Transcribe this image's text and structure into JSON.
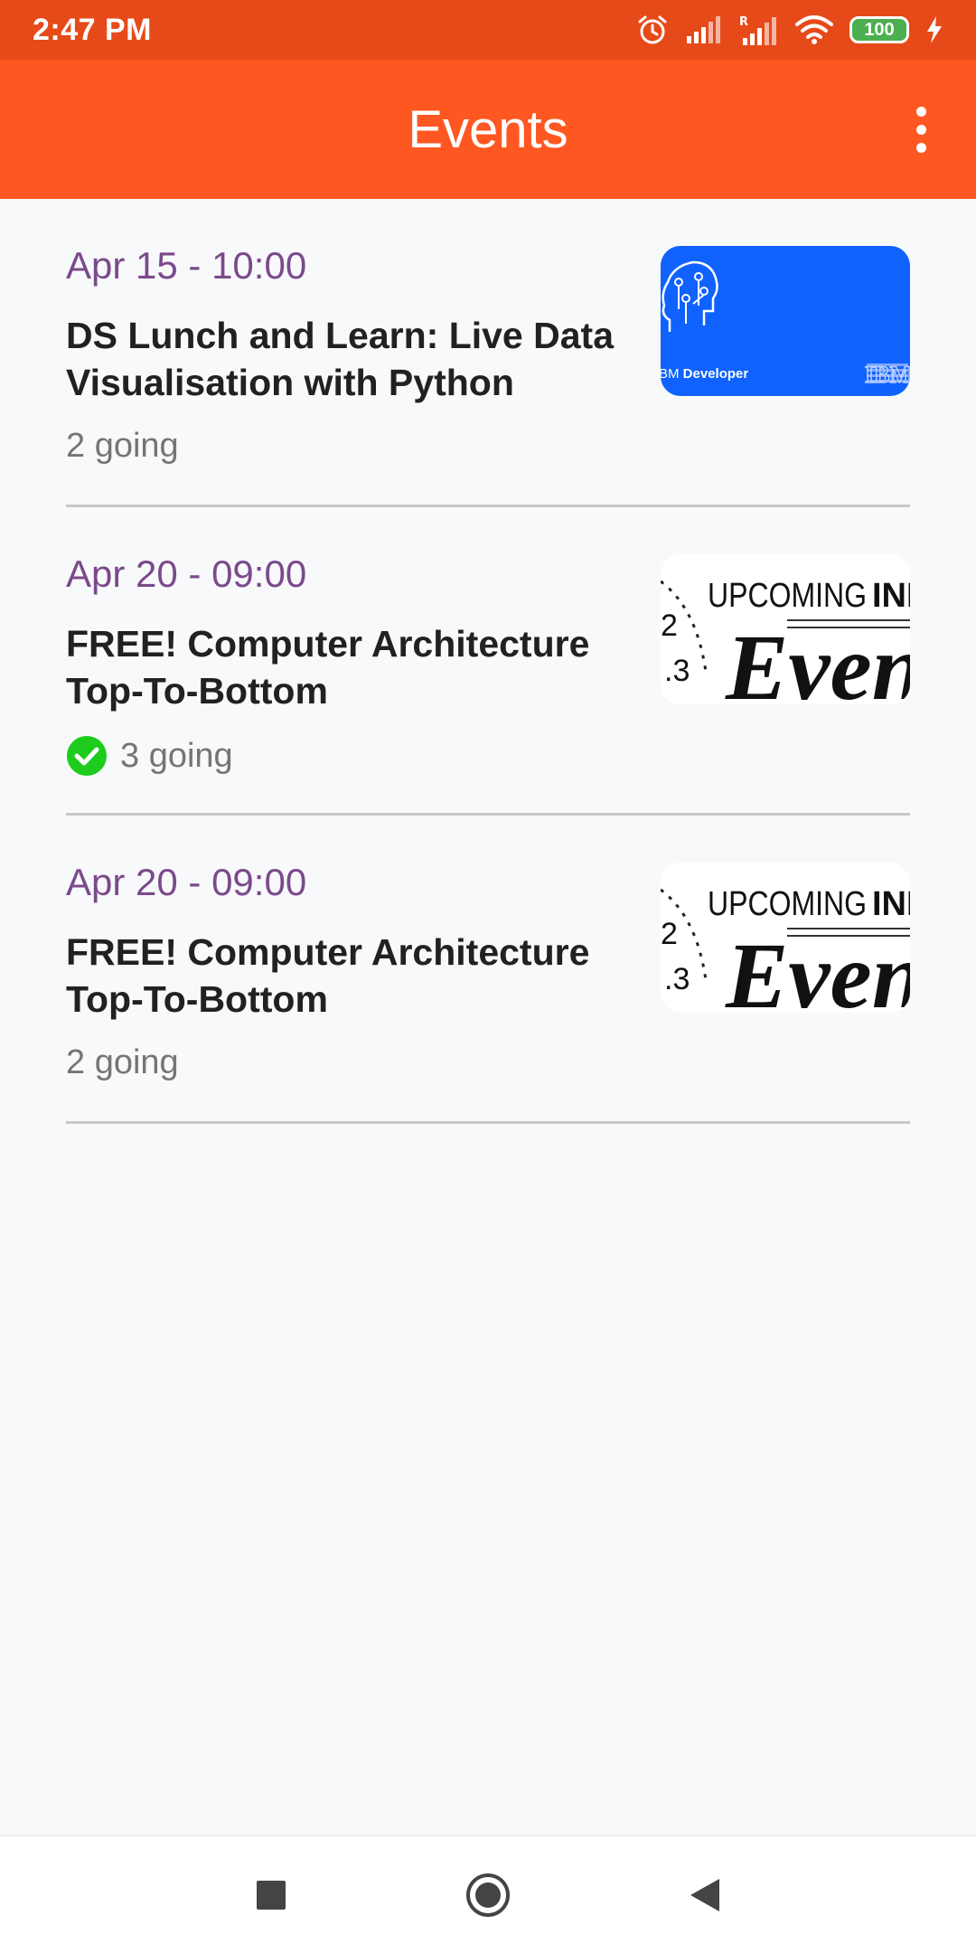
{
  "status_bar": {
    "time": "2:47 PM",
    "battery": "100",
    "icons": [
      "alarm-icon",
      "signal-icon",
      "roaming-signal-icon",
      "wifi-icon",
      "battery-icon",
      "charging-icon"
    ]
  },
  "app_bar": {
    "title": "Events",
    "menu_icon": "more-vertical-icon"
  },
  "events": [
    {
      "date": "Apr 15 - 10:00",
      "title": "DS Lunch and Learn: Live Data Visualisation with Python",
      "going": "2 going",
      "attending": false,
      "thumbnail": {
        "type": "ibm",
        "caption": "IBM Developer",
        "logo": "IBM",
        "bg": "#0F62FE"
      }
    },
    {
      "date": "Apr 20 - 09:00",
      "title": "FREE! Computer Architecture Top-To-Bottom",
      "going": "3 going",
      "attending": true,
      "thumbnail": {
        "type": "upcoming",
        "line1": "UPCOMING",
        "line1_bold": "INI",
        "script": "Even",
        "clock_numbers": [
          "2",
          "3"
        ]
      }
    },
    {
      "date": "Apr 20 - 09:00",
      "title": "FREE! Computer Architecture Top-To-Bottom",
      "going": "2 going",
      "attending": false,
      "thumbnail": {
        "type": "upcoming",
        "line1": "UPCOMING",
        "line1_bold": "INI",
        "script": "Even",
        "clock_numbers": [
          "2",
          "3"
        ]
      }
    }
  ],
  "colors": {
    "status_bar": "#E64A19",
    "app_bar": "#FF5722",
    "date_text": "#7B4A8B",
    "check_green": "#1DCC1D"
  },
  "nav_bar": {
    "icons": [
      "recents-square-icon",
      "home-circle-icon",
      "back-triangle-icon"
    ]
  }
}
